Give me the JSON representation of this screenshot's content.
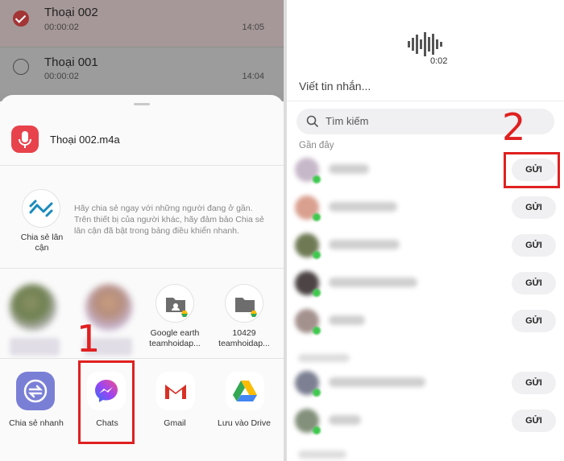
{
  "recordings": [
    {
      "name": "Thoại 002",
      "duration": "00:00:02",
      "time": "14:05",
      "selected": true
    },
    {
      "name": "Thoại 001",
      "duration": "00:00:02",
      "time": "14:04",
      "selected": false
    }
  ],
  "share_sheet": {
    "file_name": "Thoại 002.m4a",
    "nearby_share": {
      "label": "Chia sẻ lân cận",
      "description": "Hãy chia sẻ ngay với những người đang ở gần. Trên thiết bị của người khác, hãy đảm bảo Chia sẻ lân cận đã bật trong bảng điều khiển nhanh."
    },
    "direct_targets": [
      {
        "label": "Google earth teamhoidap..."
      },
      {
        "label": "10429 teamhoidap..."
      }
    ],
    "apps": [
      {
        "label": "Chia sẻ nhanh",
        "icon": "quick-share-icon"
      },
      {
        "label": "Chats",
        "icon": "messenger-icon"
      },
      {
        "label": "Gmail",
        "icon": "gmail-icon"
      },
      {
        "label": "Lưu vào Drive",
        "icon": "drive-icon"
      }
    ]
  },
  "messenger": {
    "audio_duration": "0:02",
    "message_placeholder": "Viết tin nhắn...",
    "search_placeholder": "Tìm kiếm",
    "recent_header": "Gần đây",
    "send_label": "GỬI"
  },
  "annotations": {
    "step1": "1",
    "step2": "2"
  },
  "colors": {
    "accent_red": "#e02020",
    "messenger_blue": "#1877f2",
    "online_green": "#3fc84e"
  }
}
